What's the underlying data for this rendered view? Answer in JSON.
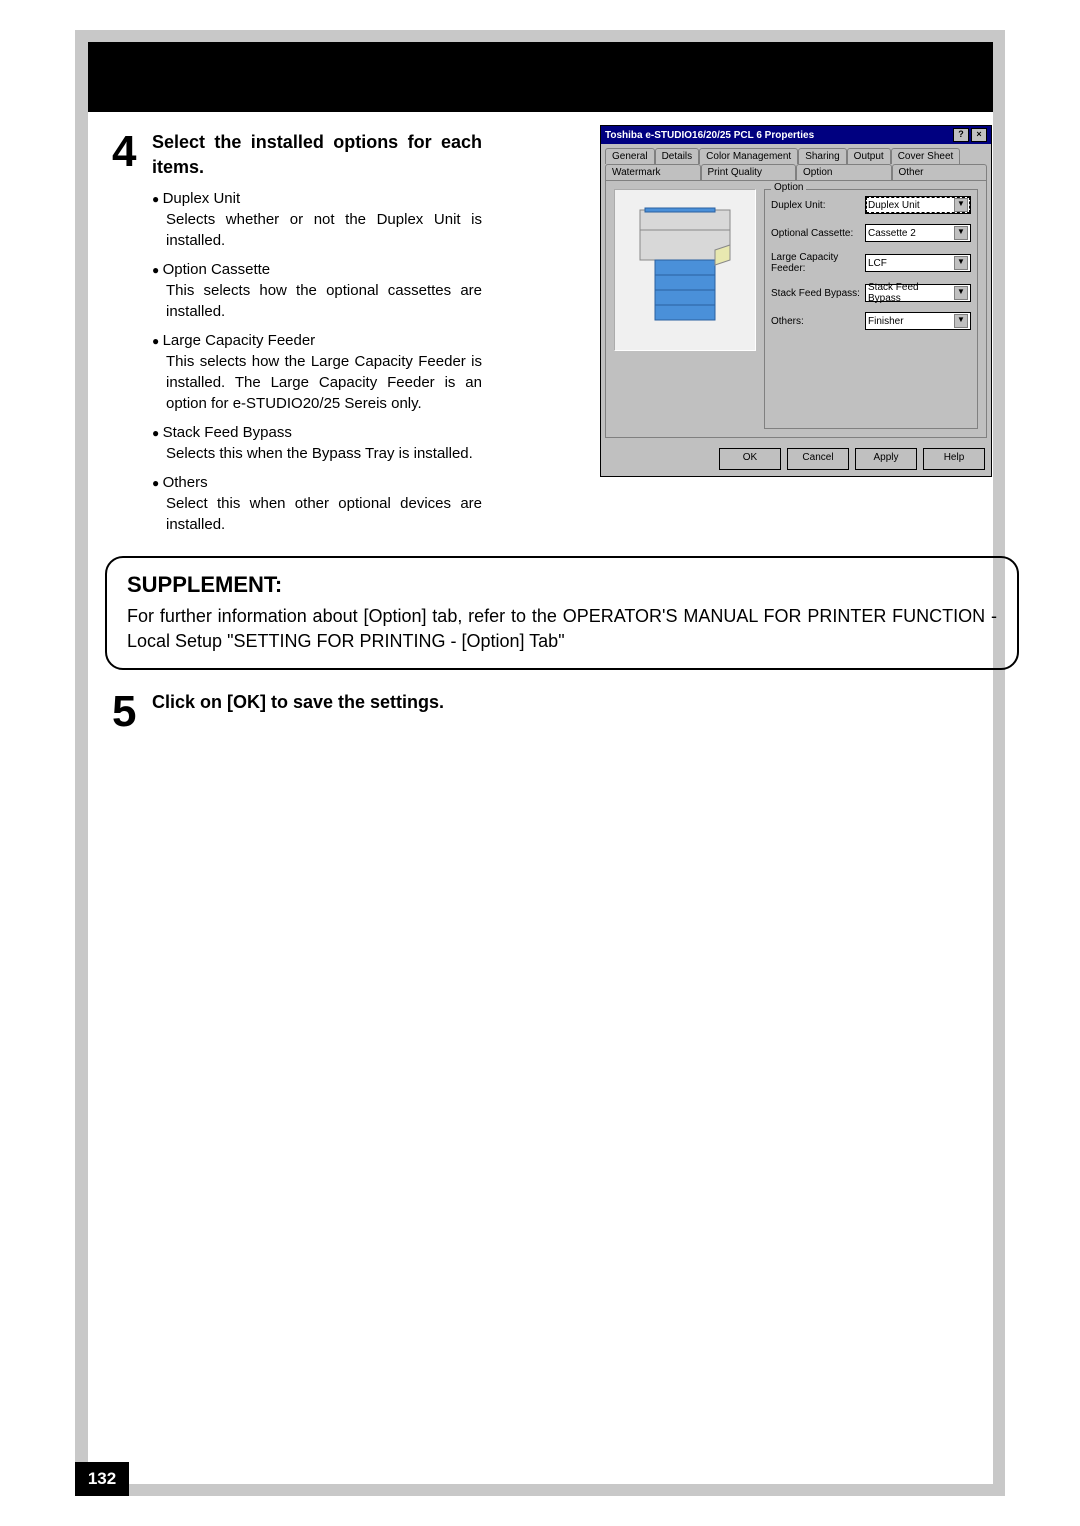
{
  "step4": {
    "number": "4",
    "title": "Select the installed options for each items.",
    "bullets": [
      {
        "head": "Duplex Unit",
        "desc": "Selects whether or not the Duplex Unit is installed."
      },
      {
        "head": "Option Cassette",
        "desc": "This selects how the optional cassettes are installed."
      },
      {
        "head": "Large Capacity Feeder",
        "desc": "This selects how the Large Capacity Feeder is installed.  The Large Capacity Feeder is an option for e-STUDIO20/25 Sereis only."
      },
      {
        "head": "Stack Feed Bypass",
        "desc": "Selects this when the Bypass Tray is installed."
      },
      {
        "head": "Others",
        "desc": "Select this when other optional devices are installed."
      }
    ]
  },
  "dialog": {
    "title": "Toshiba e-STUDIO16/20/25 PCL 6 Properties",
    "help_btn": "?",
    "close_btn": "×",
    "tabs_row1": [
      "General",
      "Details",
      "Color Management",
      "Sharing",
      "Output",
      "Cover Sheet"
    ],
    "tabs_row2": [
      "Watermark",
      "Print Quality",
      "Option",
      "Other"
    ],
    "selected_tab": "Option",
    "group_label": "Option",
    "options": [
      {
        "label": "Duplex Unit:",
        "value": "Duplex Unit",
        "focused": true
      },
      {
        "label": "Optional Cassette:",
        "value": "Cassette 2",
        "focused": false
      },
      {
        "label": "Large Capacity Feeder:",
        "value": "LCF",
        "focused": false
      },
      {
        "label": "Stack Feed Bypass:",
        "value": "Stack Feed Bypass",
        "focused": false
      },
      {
        "label": "Others:",
        "value": "Finisher",
        "focused": false
      }
    ],
    "buttons": {
      "ok": "OK",
      "cancel": "Cancel",
      "apply": "Apply",
      "help": "Help"
    }
  },
  "supplement": {
    "title": "SUPPLEMENT:",
    "body": "For further information about [Option] tab, refer to the OPERATOR'S MANUAL FOR PRINTER FUNCTION - Local Setup \"SETTING FOR PRINTING - [Option] Tab\""
  },
  "step5": {
    "number": "5",
    "title": "Click on [OK] to save the settings."
  },
  "page_number": "132"
}
